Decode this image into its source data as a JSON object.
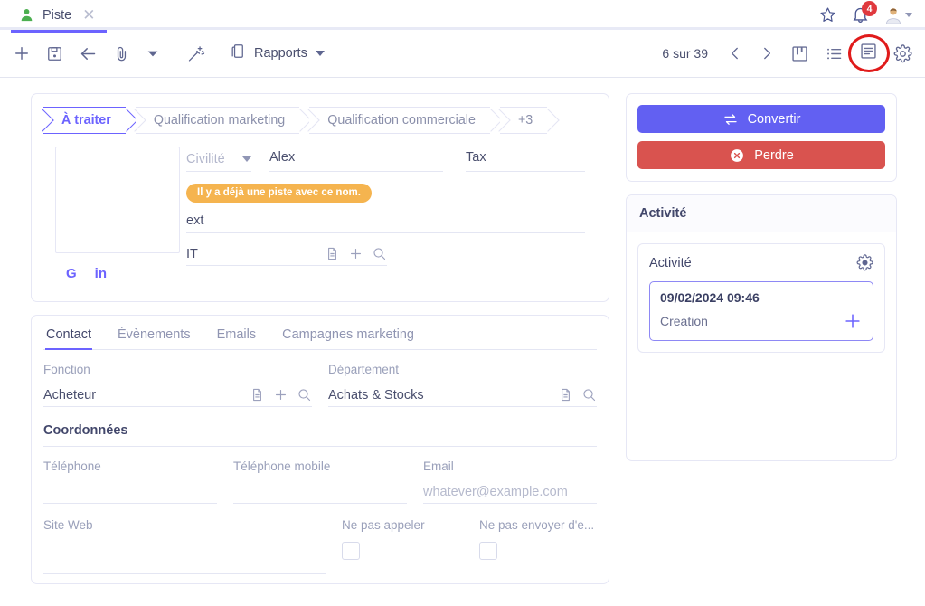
{
  "tabstrip": {
    "tab_label": "Piste",
    "close_label": "✕",
    "notification_count": "4"
  },
  "toolbar": {
    "new_icon": "plus-icon",
    "save_icon": "save-icon",
    "back_icon": "arrow-left-icon",
    "attach_icon": "paperclip-icon",
    "dropdown_icon": "caret-down-icon",
    "magic_icon": "magic-wand-icon",
    "reports_icon": "copy-icon",
    "reports_label": "Rapports",
    "pager_text": "6 sur 39",
    "prev_icon": "chevron-left-icon",
    "next_icon": "chevron-right-icon",
    "kanban_icon": "kanban-view-icon",
    "list_icon": "list-view-icon",
    "form_icon": "form-view-icon",
    "settings_icon": "gear-icon",
    "highlight_color": "#e01b1b"
  },
  "pipeline": {
    "stages": [
      {
        "label": "À traiter",
        "active": true
      },
      {
        "label": "Qualification marketing",
        "active": false
      },
      {
        "label": "Qualification commerciale",
        "active": false
      },
      {
        "label": "+3",
        "active": false
      }
    ],
    "active_color": "#6c63ff"
  },
  "lead": {
    "photo_placeholder": "",
    "social": [
      {
        "label": "G",
        "name": "google-link"
      },
      {
        "label": "in",
        "name": "linkedin-link"
      }
    ],
    "civilite_placeholder": "Civilité",
    "first_name": "Alex",
    "last_name": "Tax",
    "duplicate_warning": "Il y a déjà une piste avec ce nom.",
    "warning_color": "#f5b44f",
    "company": "ext",
    "industry": "IT"
  },
  "form_tabs": [
    {
      "label": "Contact",
      "active": true
    },
    {
      "label": "Évènements",
      "active": false
    },
    {
      "label": "Emails",
      "active": false
    },
    {
      "label": "Campagnes marketing",
      "active": false
    }
  ],
  "contact": {
    "fonction_label": "Fonction",
    "fonction_value": "Acheteur",
    "departement_label": "Département",
    "departement_value": "Achats & Stocks",
    "section_title": "Coordonnées",
    "telephone_label": "Téléphone",
    "telephone_value": "",
    "mobile_label": "Téléphone mobile",
    "mobile_value": "",
    "email_label": "Email",
    "email_placeholder": "whatever@example.com",
    "site_label": "Site Web",
    "site_value": "",
    "do_not_call_label": "Ne pas appeler",
    "do_not_email_label": "Ne pas envoyer d'e..."
  },
  "sidebar": {
    "convert_label": "Convertir",
    "convert_color": "#6260f2",
    "lose_label": "Perdre",
    "lose_color": "#d9534f",
    "activity_panel_title": "Activité",
    "activity_inner_title": "Activité",
    "activity_entry": {
      "date": "09/02/2024 09:46",
      "kind": "Creation"
    }
  }
}
